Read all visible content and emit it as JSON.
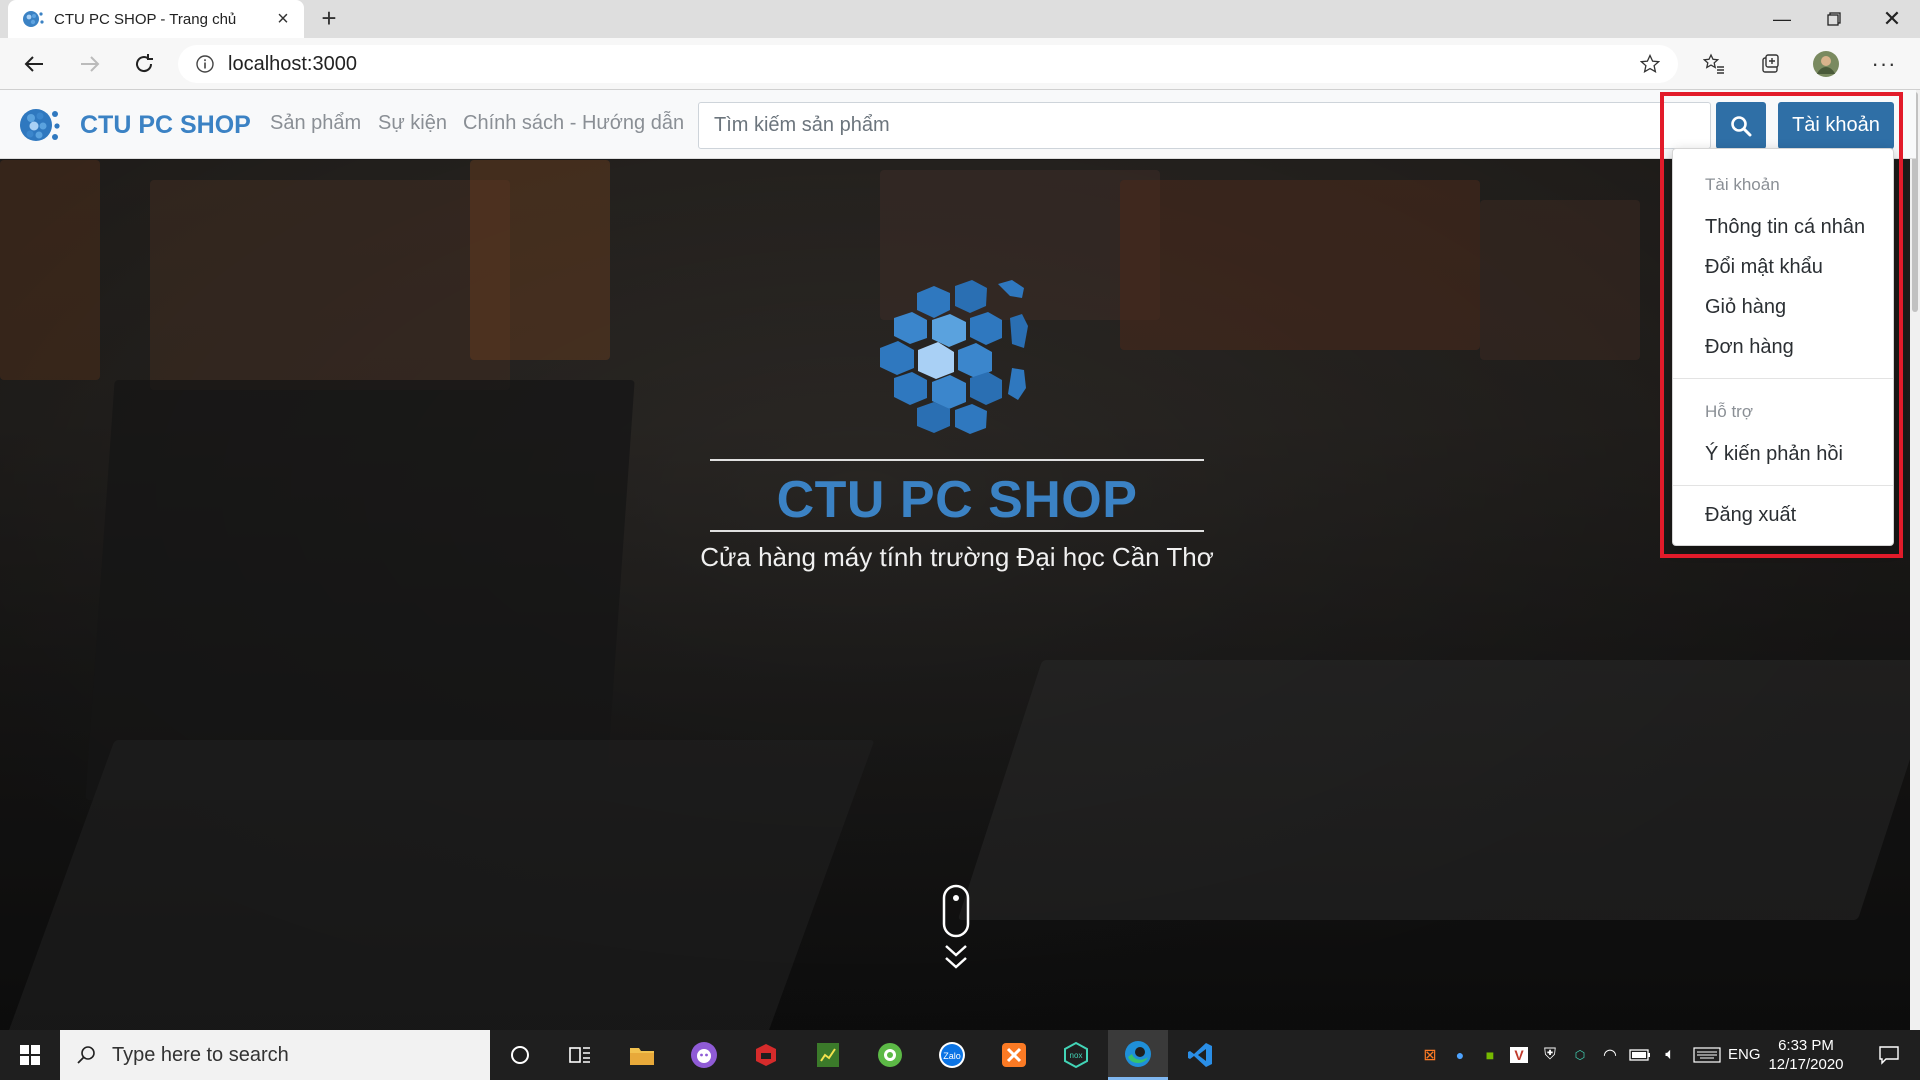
{
  "browser": {
    "tab_title": "CTU PC SHOP - Trang chủ",
    "url": "localhost:3000"
  },
  "site": {
    "brand": "CTU PC SHOP",
    "nav": [
      "Sản phẩm",
      "Sự kiện",
      "Chính sách - Hướng dẫn"
    ],
    "search_placeholder": "Tìm kiếm sản phẩm",
    "account_label": "Tài khoản"
  },
  "hero": {
    "title": "CTU PC SHOP",
    "subtitle": "Cửa hàng máy tính trường Đại học Cần Thơ"
  },
  "dropdown": {
    "account_header": "Tài khoản",
    "account_items": [
      "Thông tin cá nhân",
      "Đổi mật khẩu",
      "Giỏ hàng",
      "Đơn hàng"
    ],
    "support_header": "Hỗ trợ",
    "support_items": [
      "Ý kiến phản hồi"
    ],
    "logout": "Đăng xuất"
  },
  "taskbar": {
    "search_placeholder": "Type here to search",
    "language": "ENG",
    "time": "6:33 PM",
    "date": "12/17/2020"
  },
  "colors": {
    "brand_blue": "#3b82c4",
    "button_blue": "#2f6fa6",
    "highlight_red": "#e21b2a"
  }
}
